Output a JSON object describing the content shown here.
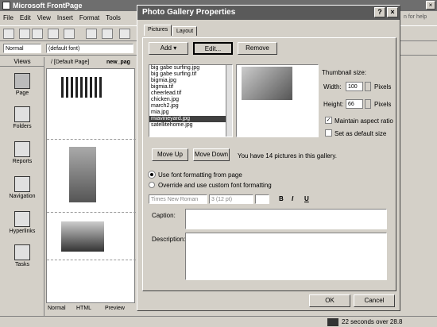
{
  "app": {
    "title": "Microsoft FrontPage",
    "help_text": "n for help"
  },
  "menu": [
    "File",
    "Edit",
    "View",
    "Insert",
    "Format",
    "Tools"
  ],
  "toolbar": {
    "style": "Normal",
    "font": "(default font)"
  },
  "views": {
    "header": "Views",
    "items": [
      "Page",
      "Folders",
      "Reports",
      "Navigation",
      "Hyperlinks",
      "Tasks"
    ]
  },
  "editor": {
    "tabs": [
      "/ [Default Page]",
      "new_pag"
    ],
    "bottom_tabs": [
      "Normal",
      "HTML",
      "Preview"
    ]
  },
  "dialog": {
    "title": "Photo Gallery Properties",
    "tabs": [
      "Pictures",
      "Layout"
    ],
    "add": "Add",
    "edit": "Edit...",
    "remove": "Remove",
    "files": [
      "big gabe surfing.jpg",
      "big gabe surfing.tif",
      "bigmia.jpg",
      "bigmia.tif",
      "cheerlead.tif",
      "chicken.jpg",
      "march2.jpg",
      "mia.jpg",
      "miavineyard.jpg",
      "satellitehome.jpg"
    ],
    "selected_index": 8,
    "thumbnail_size_label": "Thumbnail size:",
    "width_label": "Width:",
    "width_value": "100",
    "height_label": "Height:",
    "height_value": "66",
    "pixels": "Pixels",
    "maintain_aspect": "Maintain aspect ratio",
    "set_default": "Set as default size",
    "move_up": "Move Up",
    "move_down": "Move Down",
    "count_text": "You have 14 pictures in this gallery.",
    "radio_font": "Use font formatting from page",
    "radio_custom": "Override and use custom font formatting",
    "font_name": "Times New Roman",
    "font_size": "3 (12 pt)",
    "caption_label": "Caption:",
    "description_label": "Description:",
    "ok": "OK",
    "cancel": "Cancel"
  },
  "status": {
    "text": "22 seconds over 28.8"
  }
}
